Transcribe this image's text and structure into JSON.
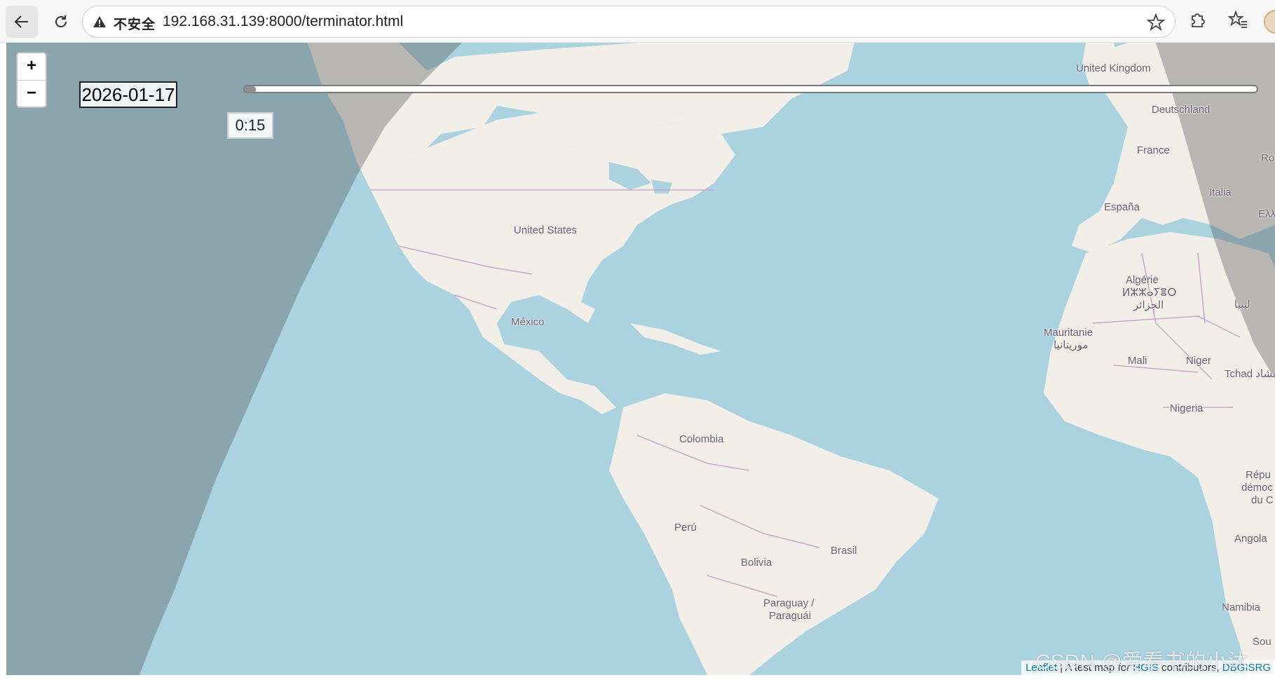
{
  "browser": {
    "security_label": "不安全",
    "url": "192.168.31.139:8000/terminator.html"
  },
  "map": {
    "zoom_in_label": "+",
    "zoom_out_label": "−",
    "date_value": "2026-01-17",
    "time_value": "0:15",
    "slider_fraction": 0.0,
    "attribution": {
      "leaflet": "Leaflet",
      "separator": " | A test map for ",
      "hgis": "HGIS",
      "contributors": " contributors, ",
      "dbgis": "DBGISRG"
    },
    "watermark": "CSDN @爱看书的小沐",
    "labels": {
      "united_kingdom": "United Kingdom",
      "deutschland": "Deutschland",
      "france": "France",
      "espana": "España",
      "italia": "Italia",
      "ellada": "Ελλ",
      "romania": "Ro",
      "united_states": "United States",
      "mexico": "México",
      "algerie": "Algérie",
      "algerie_tifinagh": "ⵍⵣⵣⴰⵢⴻⵔ",
      "algerie_arabic": "الجزائر",
      "libya": "ليبيا",
      "mauritanie": "Mauritanie",
      "mauritanie_arabic": "موريتانيا",
      "mali": "Mali",
      "niger": "Niger",
      "tchad": "Tchad تشاد",
      "nigeria": "Nigeria",
      "colombia": "Colombia",
      "peru": "Perú",
      "brasil": "Brasil",
      "bolivia": "Bolivia",
      "paraguay": "Paraguay /",
      "paraguai": "Paraguái",
      "rdc_1": "Répu",
      "rdc_2": "démoc",
      "rdc_3": "du C",
      "angola": "Angola",
      "namibia": "Namibia",
      "south_africa": "Sou"
    }
  },
  "colors": {
    "ocean": "#aad3df",
    "land": "#f2efe9",
    "night_overlay": "rgba(80,80,80,0.35)",
    "border": "#c8a8c8"
  }
}
